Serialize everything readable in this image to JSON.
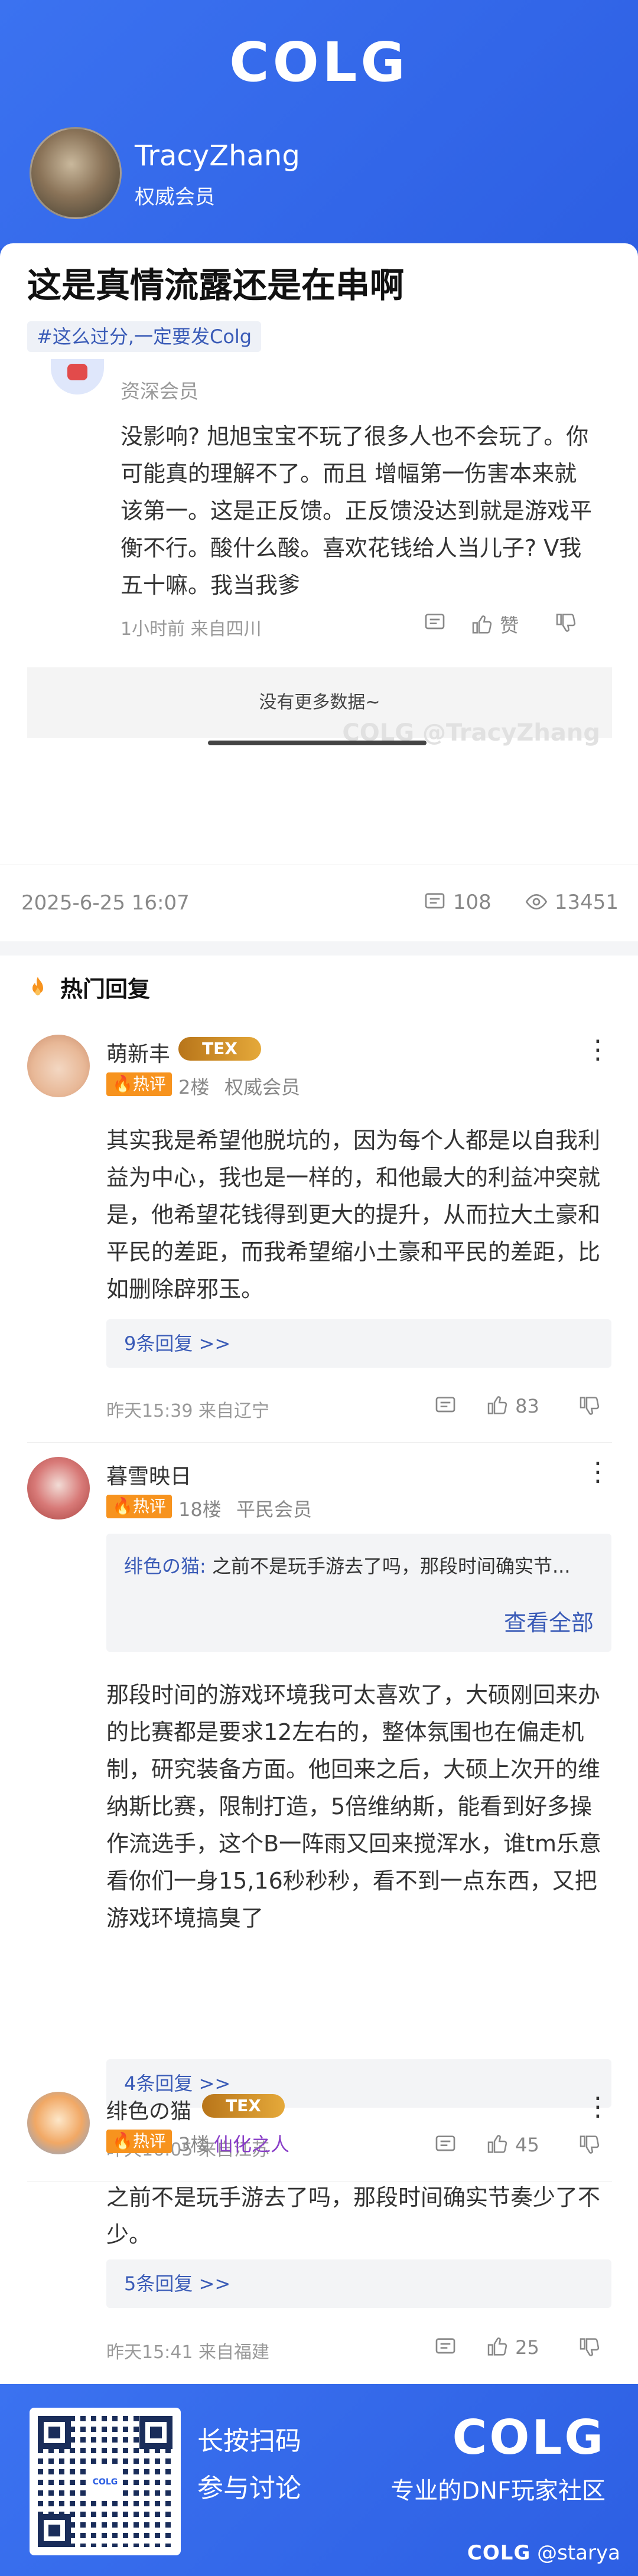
{
  "hero": {
    "logo": "COLG",
    "username": "TracyZhang",
    "role": "权威会员"
  },
  "post": {
    "title": "这是真情流露还是在串啊",
    "tag": "#这么过分,一定要发Colg"
  },
  "embedded_reply": {
    "role": "资深会员",
    "text": "没影响? 旭旭宝宝不玩了很多人也不会玩了。你可能真的理解不了。而且 增幅第一伤害本来就该第一。这是正反馈。正反馈没达到就是游戏平衡不行。酸什么酸。喜欢花钱给人当儿子? V我五十嘛。我当我爹",
    "meta": "1小时前 来自四川",
    "like_label": "赞",
    "no_more": "没有更多数据~",
    "watermark": "COLG @TracyZhang"
  },
  "stats": {
    "date": "2025-6-25 16:07",
    "comments": "108",
    "views": "13451"
  },
  "hot_section": {
    "title": "热门回复"
  },
  "comments": [
    {
      "name": "萌新丰",
      "badge": "TEX",
      "hot_label": "热评",
      "floor": "2楼",
      "member": "权威会员",
      "text": "其实我是希望他脱坑的，因为每个人都是以自我利益为中心，我也是一样的，和他最大的利益冲突就是，他希望花钱得到更大的提升，从而拉大土豪和平民的差距，而我希望缩小土豪和平民的差距，比如删除辟邪玉。",
      "replies": "9条回复 >>",
      "meta": "昨天15:39 来自辽宁",
      "likes": "83"
    },
    {
      "name": "暮雪映日",
      "hot_label": "热评",
      "floor": "18楼",
      "member": "平民会员",
      "quote_user": "绯色の猫:",
      "quote_text": "之前不是玩手游去了吗，那段时间确实节...",
      "quote_more": "查看全部",
      "text": "那段时间的游戏环境我可太喜欢了，大硕刚回来办的比赛都是要求12左右的，整体氛围也在偏走机制，研究装备方面。他回来之后，大硕上次开的维纳斯比赛，限制打造，5倍维纳斯，能看到好多操作流选手，这个B一阵雨又回来搅浑水，谁tm乐意看你们一身15,16秒秒秒，看不到一点东西，又把游戏环境搞臭了",
      "replies": "4条回复 >>",
      "meta": "昨天16:05 来自江苏",
      "likes": "45"
    },
    {
      "name": "绯色の猫",
      "badge": "TEX",
      "hot_label": "热评",
      "floor": "3楼",
      "member": "仙化之人",
      "text": "之前不是玩手游去了吗，那段时间确实节奏少了不少。",
      "replies": "5条回复 >>",
      "meta": "昨天15:41 来自福建",
      "likes": "25"
    }
  ],
  "footer": {
    "qr_logo": "COLG",
    "line1": "长按扫码",
    "line2": "参与讨论",
    "logo": "COLG",
    "slogan": "专业的DNF玩家社区",
    "watermark_brand": "COLG",
    "watermark_user": "@starya"
  },
  "colors": {
    "brand_blue": "#2f63e6",
    "hot_orange": "#f7931e",
    "link_blue": "#3a5bb7",
    "member_purple": "#8a3fc8"
  }
}
